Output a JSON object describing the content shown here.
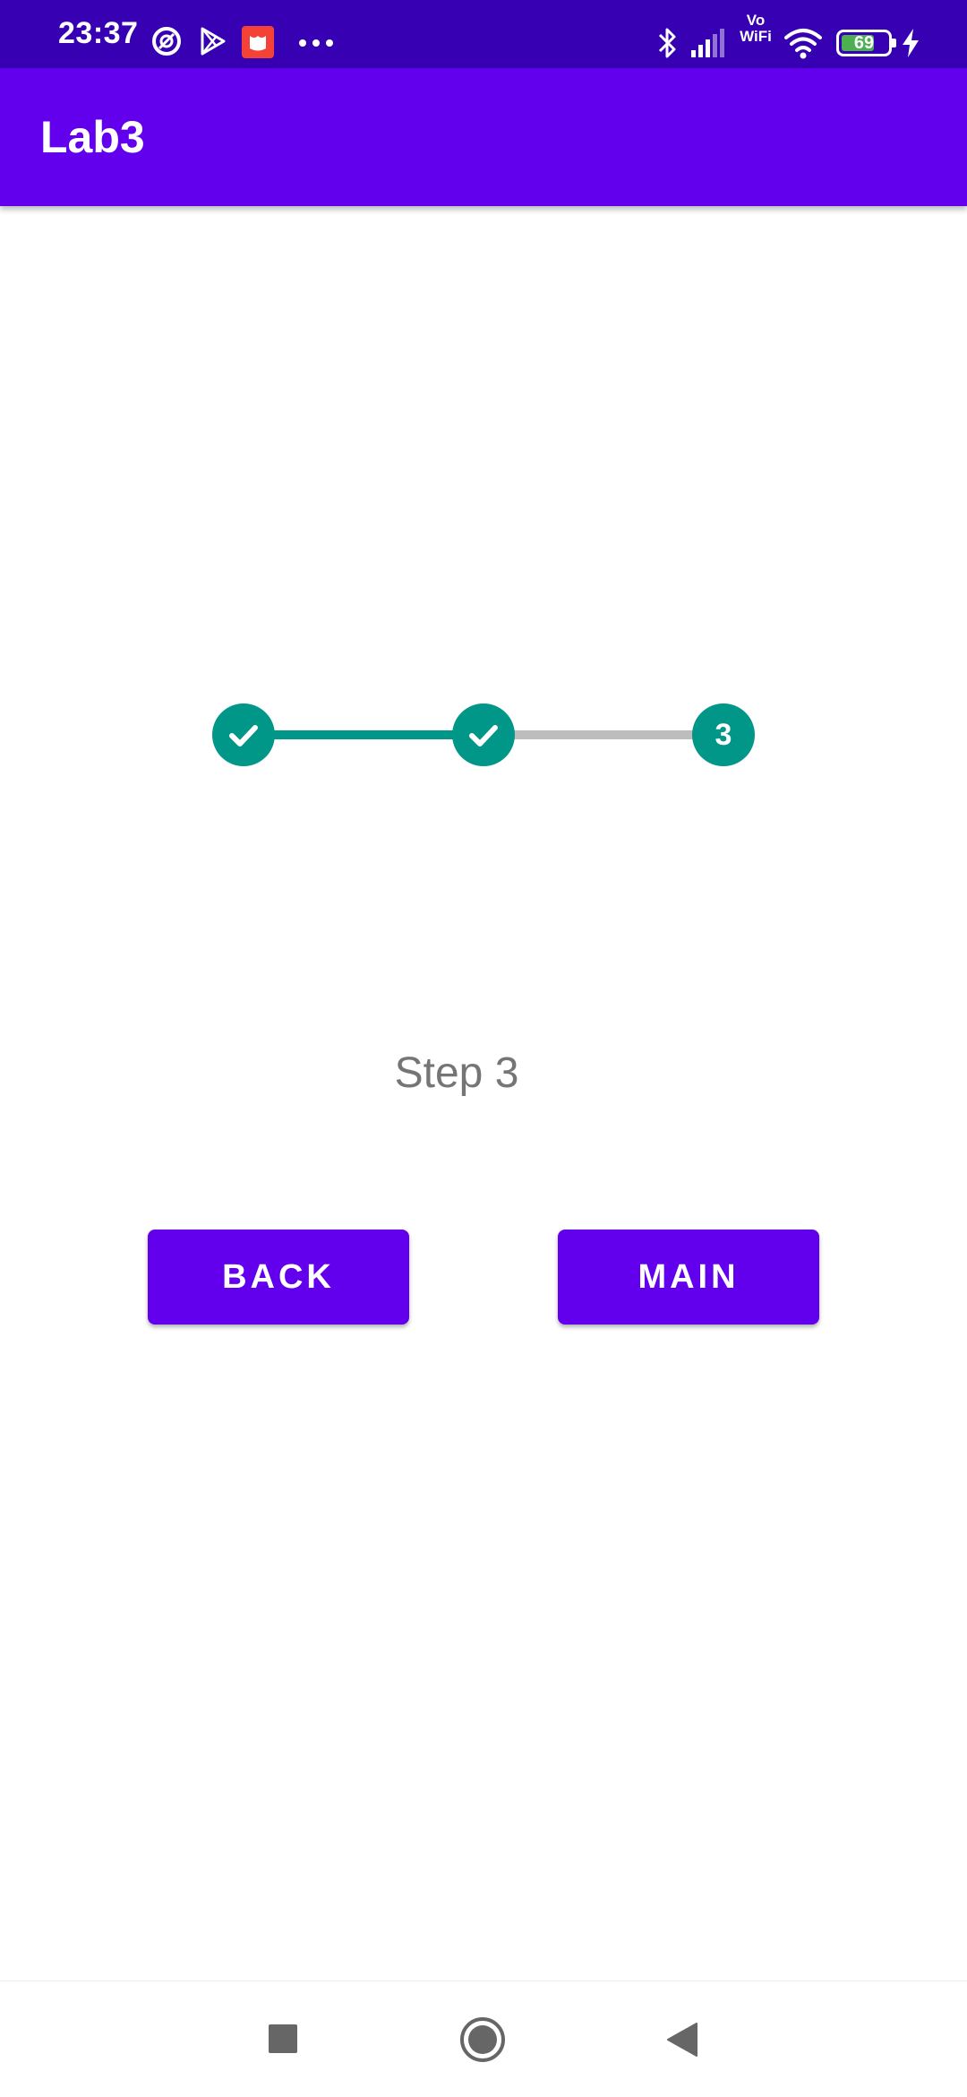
{
  "status_bar": {
    "time": "23:37",
    "vowifi_top": "Vo",
    "vowifi_bottom": "WiFi",
    "battery": "69",
    "icons": [
      "focus-icon",
      "play-store-icon",
      "notification-app-icon",
      "more-dots-icon",
      "bluetooth-icon",
      "signal-icon",
      "vowifi-icon",
      "wifi-icon",
      "battery-icon",
      "charging-icon"
    ]
  },
  "app_bar": {
    "title": "Lab3"
  },
  "stepper": {
    "steps": [
      {
        "state": "completed",
        "icon": "check-icon"
      },
      {
        "state": "completed",
        "icon": "check-icon"
      },
      {
        "state": "current",
        "label": "3"
      }
    ],
    "active_color": "#009688",
    "inactive_color": "#bdbdbd"
  },
  "content": {
    "step_label": "Step 3"
  },
  "buttons": {
    "back": "BACK",
    "main": "MAIN"
  },
  "nav_bar": {
    "icons": [
      "recents-icon",
      "home-icon",
      "back-icon"
    ]
  },
  "colors": {
    "primary": "#6200ee",
    "primary_dark": "#3700b3",
    "accent": "#009688"
  }
}
